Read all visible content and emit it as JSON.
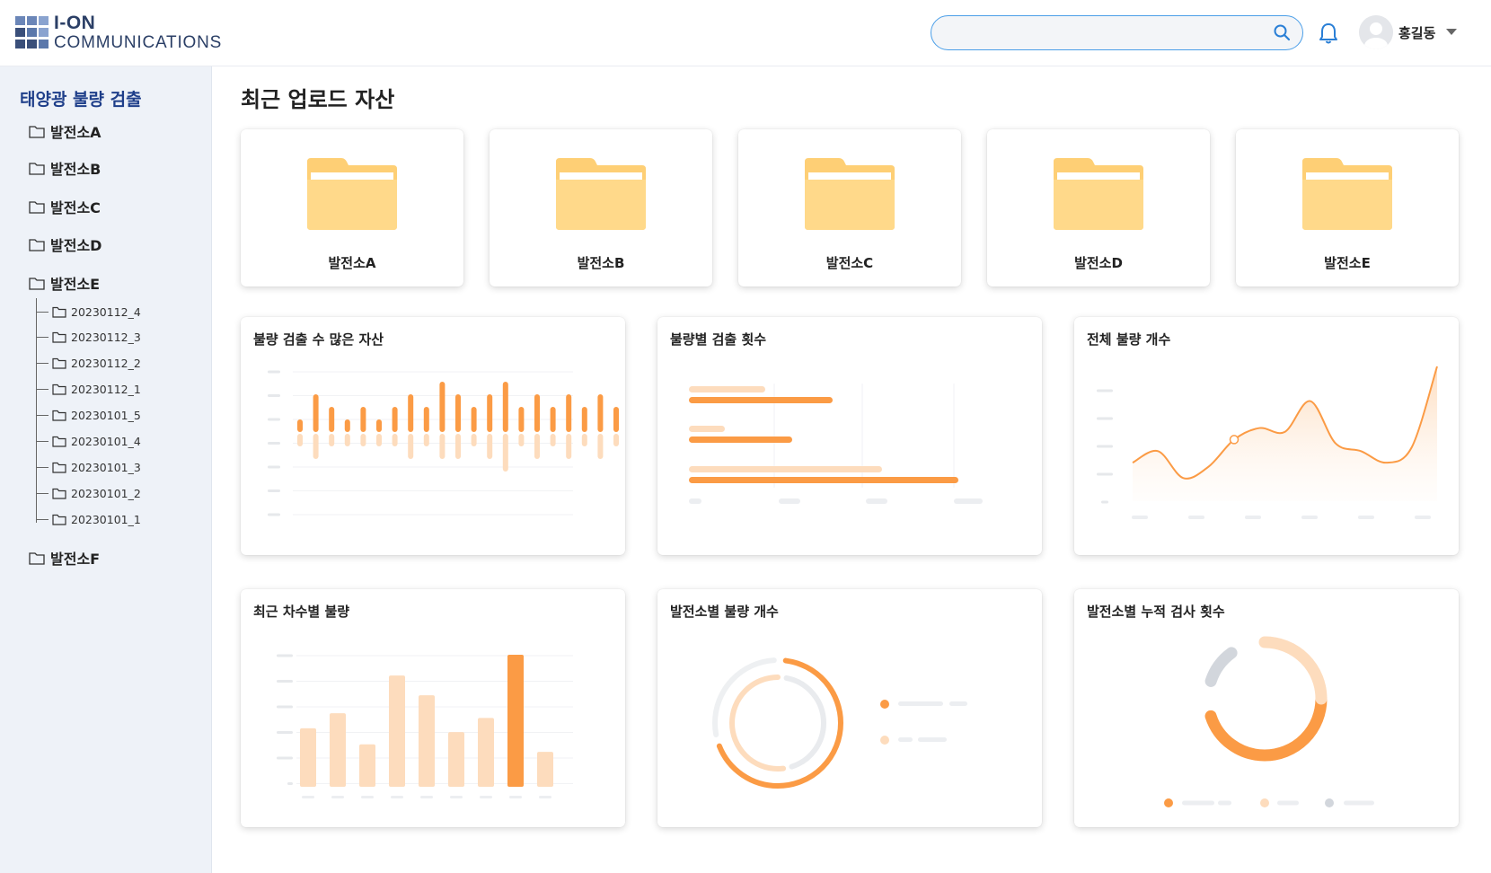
{
  "header": {
    "logo_title": "I-ON",
    "logo_subtitle": "COMMUNICATIONS",
    "search_placeholder": "",
    "user_name": "홍길동"
  },
  "sidebar": {
    "title": "태양광 불량 검출",
    "items": [
      {
        "label": "발전소A"
      },
      {
        "label": "발전소B"
      },
      {
        "label": "발전소C"
      },
      {
        "label": "발전소D"
      },
      {
        "label": "발전소E"
      },
      {
        "label": "발전소F"
      }
    ],
    "subitems": [
      {
        "label": "20230112_4"
      },
      {
        "label": "20230112_3"
      },
      {
        "label": "20230112_2"
      },
      {
        "label": "20230112_1"
      },
      {
        "label": "20230101_5"
      },
      {
        "label": "20230101_4"
      },
      {
        "label": "20230101_3"
      },
      {
        "label": "20230101_2"
      },
      {
        "label": "20230101_1"
      }
    ]
  },
  "main": {
    "title": "최근 업로드 자산",
    "folders": [
      {
        "label": "발전소A"
      },
      {
        "label": "발전소B"
      },
      {
        "label": "발전소C"
      },
      {
        "label": "발전소D"
      },
      {
        "label": "발전소E"
      }
    ],
    "charts": [
      {
        "title": "불량 검출 수 많은 자산"
      },
      {
        "title": "불량별 검출 횟수"
      },
      {
        "title": "전체 불량 개수"
      },
      {
        "title": "최근 차수별 불량"
      },
      {
        "title": "발전소별 불량 개수"
      },
      {
        "title": "발전소별 누적 검사 횟수"
      }
    ]
  },
  "colors": {
    "accent": "#fb9b45",
    "accent_light": "#fddcbd",
    "grey_light": "#d2d6dc",
    "folder": "#ffd98a",
    "folder_tab": "#fecf75",
    "brand": "#2b3f66",
    "sidebar_bg": "#eef2f8"
  },
  "icons": [
    "search-icon",
    "bell-icon",
    "avatar-icon",
    "chevron-down-icon",
    "folder-icon"
  ],
  "chart_data": [
    {
      "type": "bar",
      "title": "불량 검출 수 많은 자산",
      "series": [
        {
          "values": [
            1,
            3,
            2,
            1,
            2,
            1,
            2,
            3,
            2,
            4,
            3,
            2,
            3,
            4,
            2,
            3,
            2,
            3,
            2,
            3,
            2,
            3
          ]
        },
        {
          "values": [
            1,
            2,
            1,
            1,
            1,
            1,
            1,
            2,
            1,
            2,
            2,
            1,
            2,
            3,
            1,
            2,
            1,
            2,
            1,
            2,
            1,
            2
          ]
        }
      ]
    },
    {
      "type": "bar",
      "title": "불량별 검출 횟수",
      "series": [
        {
          "values": [
            160,
            115,
            300
          ]
        },
        {
          "values": [
            85,
            40,
            215
          ]
        }
      ]
    },
    {
      "type": "area",
      "title": "전체 불량 개수",
      "series": [
        {
          "values": [
            20,
            26,
            12,
            18,
            32,
            38,
            36,
            52,
            30,
            26,
            20,
            28,
            70
          ]
        }
      ]
    },
    {
      "type": "bar",
      "title": "최근 차수별 불량",
      "values": [
        62,
        78,
        45,
        118,
        97,
        58,
        73,
        140,
        37
      ]
    },
    {
      "type": "pie",
      "title": "발전소별 불량 개수",
      "series": [
        {
          "values": [
            70,
            30
          ]
        },
        {
          "values": [
            55,
            45
          ]
        }
      ]
    },
    {
      "type": "pie",
      "title": "발전소별 누적 검사 횟수",
      "values": [
        45,
        25,
        10
      ]
    }
  ]
}
